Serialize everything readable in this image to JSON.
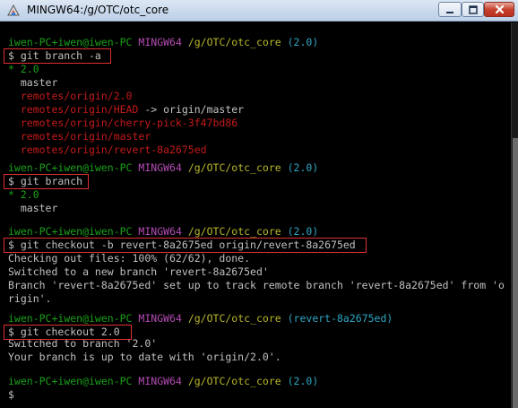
{
  "window": {
    "title": "MINGW64:/g/OTC/otc_core"
  },
  "colors": {
    "user_host": "#19a019",
    "env": "#b24bb2",
    "path": "#b8b52b",
    "branch": "#2ea6c2",
    "remote_branch": "#c41a1a",
    "text": "#c0c0c0",
    "highlight_box": "#e03030"
  },
  "terminal": {
    "block1": {
      "prompt_user": "iwen-PC+iwen@iwen-PC",
      "prompt_env": "MINGW64",
      "prompt_path": "/g/OTC/otc_core",
      "prompt_branch": "(2.0)",
      "command": "$ git branch -a",
      "current_branch": "* 2.0",
      "branch_master": "  master",
      "remote1": "  remotes/origin/2.0",
      "remote2_name": "  remotes/origin/HEAD",
      "remote2_target": " -> origin/master",
      "remote3": "  remotes/origin/cherry-pick-3f47bd86",
      "remote4": "  remotes/origin/master",
      "remote5": "  remotes/origin/revert-8a2675ed"
    },
    "block2": {
      "prompt_user": "iwen-PC+iwen@iwen-PC",
      "prompt_env": "MINGW64",
      "prompt_path": "/g/OTC/otc_core",
      "prompt_branch": "(2.0)",
      "command": "$ git branch",
      "current_branch": "* 2.0",
      "branch_master": "  master"
    },
    "block3": {
      "prompt_user": "iwen-PC+iwen@iwen-PC",
      "prompt_env": "MINGW64",
      "prompt_path": "/g/OTC/otc_core",
      "prompt_branch": "(2.0)",
      "command": "$ git checkout -b revert-8a2675ed origin/revert-8a2675ed",
      "out1": "Checking out files: 100% (62/62), done.",
      "out2": "Switched to a new branch 'revert-8a2675ed'",
      "out3": "Branch 'revert-8a2675ed' set up to track remote branch 'revert-8a2675ed' from 'o",
      "out4": "rigin'."
    },
    "block4": {
      "prompt_user": "iwen-PC+iwen@iwen-PC",
      "prompt_env": "MINGW64",
      "prompt_path": "/g/OTC/otc_core",
      "prompt_branch": "(revert-8a2675ed)",
      "command": "$ git checkout 2.0",
      "out1": "Switched to branch '2.0'",
      "out2": "Your branch is up to date with 'origin/2.0'."
    },
    "block5": {
      "prompt_user": "iwen-PC+iwen@iwen-PC",
      "prompt_env": "MINGW64",
      "prompt_path": "/g/OTC/otc_core",
      "prompt_branch": "(2.0)",
      "command": "$"
    }
  }
}
